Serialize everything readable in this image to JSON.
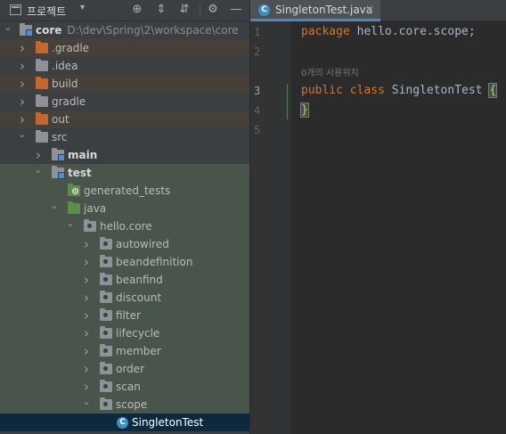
{
  "panel": {
    "title": "프로젝트",
    "dropdown_glyph": "▾",
    "tools": [
      "crosshair-icon",
      "expand-all-icon",
      "collapse-all-icon",
      "gear-icon",
      "minimize-icon"
    ]
  },
  "tree": {
    "root": {
      "label": "core",
      "path": "D:\\dev\\Spring\\2\\workspace\\core"
    },
    "items": {
      "gradle_dir": ".gradle",
      "idea": ".idea",
      "build": "build",
      "gradle": "gradle",
      "out": "out",
      "src": "src",
      "main": "main",
      "test": "test",
      "generated_tests": "generated_tests",
      "java": "java",
      "hello_core": "hello.core",
      "autowired": "autowired",
      "beandefinition": "beandefinition",
      "beanfind": "beanfind",
      "discount": "discount",
      "filter": "filter",
      "lifecycle": "lifecycle",
      "member": "member",
      "order": "order",
      "scan": "scan",
      "scope": "scope",
      "singleton_test": "SingletonTest"
    }
  },
  "editor": {
    "tab": {
      "label": "SingletonTest.java",
      "icon_letter": "C",
      "close": "×"
    },
    "line_numbers": [
      "1",
      "2",
      "3",
      "4",
      "5"
    ],
    "code": {
      "line1_kw": "package",
      "line1_rest": " hello.core.scope;",
      "usage_hint": "0개의 사용위치",
      "line3_kw1": "public",
      "line3_kw2": " class",
      "line3_name": " SingletonTest ",
      "line3_brace": "{",
      "line4_brace": "}"
    }
  },
  "colors": {
    "keyword": "#cc7832",
    "brace": "#e8c046",
    "selection": "#0d293e",
    "accent": "#4a88c7"
  }
}
